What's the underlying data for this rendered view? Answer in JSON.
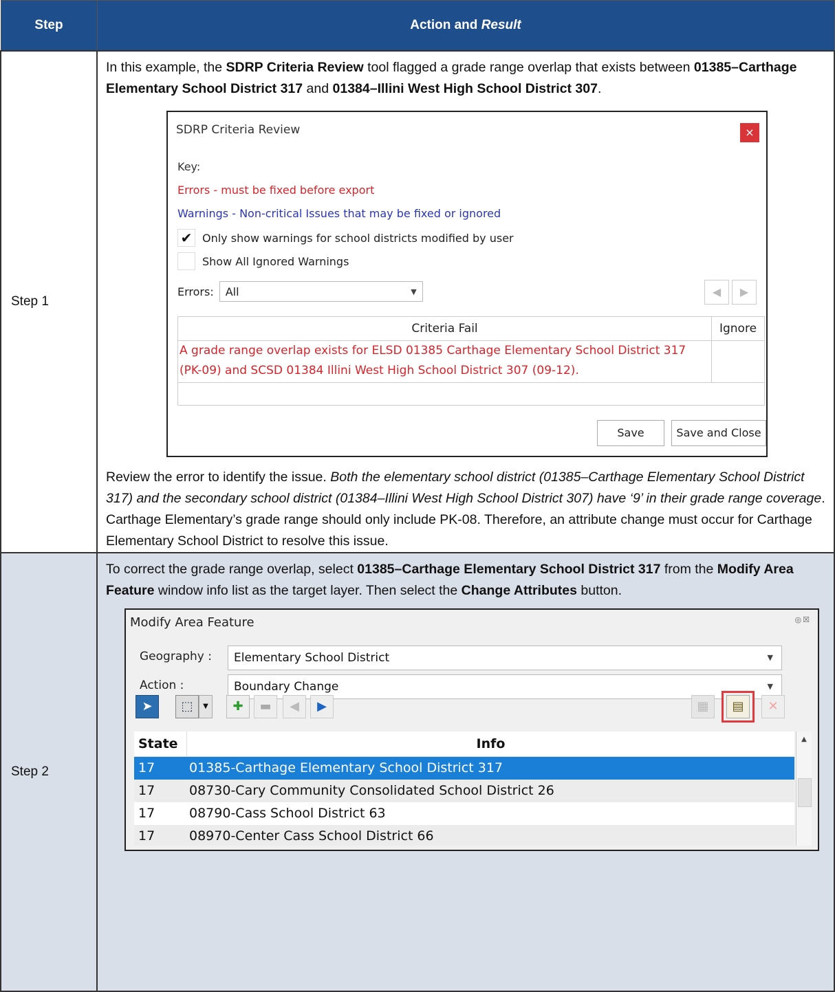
{
  "header": {
    "step": "Step",
    "action_prefix": "Action and ",
    "action_italic": "Result"
  },
  "rows": [
    {
      "step": "Step 1",
      "intro": {
        "t1": "In this example, the ",
        "b1": "SDRP Criteria Review",
        "t2": " tool flagged a grade range overlap that exists between ",
        "b2": "01385–Carthage Elementary School District 317",
        "t3": " and ",
        "b3": "01384–Illini West High School District 307",
        "t4": "."
      },
      "outro": {
        "t1": "Review the error to identify the issue. ",
        "i1": "Both the elementary school district (01385–Carthage Elementary School District 317) and the secondary school district (01384–Illini West High School District 307) have ‘9’ in their grade range coverage",
        "t2": ". Carthage Elementary’s grade range should only include PK-08. Therefore, an attribute change must occur for Carthage Elementary School District to resolve this issue."
      }
    },
    {
      "step": "Step 2",
      "intro": {
        "t1": "To correct the grade range overlap, select ",
        "b1": "01385–Carthage Elementary School District 317",
        "t2": " from the ",
        "b2": "Modify Area Feature",
        "t3": " window info list as the target layer. Then select the ",
        "b3": "Change Attributes",
        "t4": " button."
      }
    }
  ],
  "sdrp": {
    "title": "SDRP Criteria Review",
    "close": "×",
    "key": "Key:",
    "errors_line": "Errors - must be fixed before export",
    "warnings_line": "Warnings - Non-critical Issues that may be fixed or ignored",
    "only_show": {
      "checked": "✔",
      "label": "Only show warnings for school districts modified by user"
    },
    "show_ignored": {
      "label": "Show All Ignored Warnings"
    },
    "errors_label": "Errors:",
    "errors_value": "All",
    "col_criteria": "Criteria Fail",
    "col_ignore": "Ignore",
    "error_text": "A grade range overlap exists for ELSD 01385 Carthage Elementary School District 317 (PK-09) and SCSD 01384 Illini West High School District 307 (09-12).",
    "save": "Save",
    "save_close": "Save and Close",
    "error_color": "#d8242b",
    "warning_color": "#2b35b8"
  },
  "maf": {
    "title": "Modify Area Feature",
    "geography_label": "Geography :",
    "geography_value": "Elementary School District",
    "action_label": "Action :",
    "action_value": "Boundary Change",
    "col_state": "State",
    "col_info": "Info",
    "rows": [
      {
        "state": "17",
        "info": "01385-Carthage Elementary School District 317"
      },
      {
        "state": "17",
        "info": "08730-Cary Community Consolidated School District 26"
      },
      {
        "state": "17",
        "info": "08790-Cass School District 63"
      },
      {
        "state": "17",
        "info": "08970-Center Cass School District 66"
      }
    ],
    "selected_color": "#1a7fd6",
    "highlight_color": "#e0393e"
  }
}
